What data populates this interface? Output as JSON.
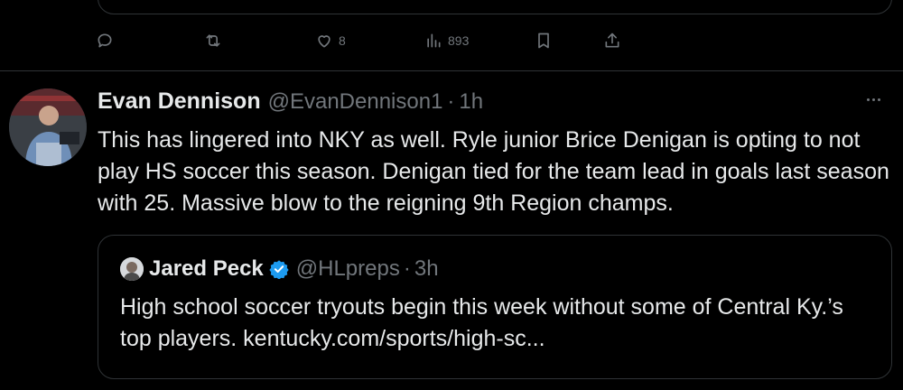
{
  "previous_tweet": {
    "actions": {
      "reply": {
        "icon": "reply-icon",
        "count": ""
      },
      "retweet": {
        "icon": "retweet-icon",
        "count": ""
      },
      "like": {
        "icon": "heart-icon",
        "count": "8"
      },
      "views": {
        "icon": "views-chart-icon",
        "count": "893"
      },
      "bookmark": {
        "icon": "bookmark-icon"
      },
      "share": {
        "icon": "share-icon"
      }
    }
  },
  "tweet": {
    "author_name": "Evan Dennison",
    "handle": "@EvanDennison1",
    "separator": "·",
    "time": "1h",
    "text": "This has lingered into NKY as well. Ryle junior Brice Denigan is opting to not play HS soccer this season. Denigan tied for the team lead in goals last season with 25. Massive blow to the reigning 9th Region champs.",
    "quoted": {
      "author_name": "Jared Peck",
      "verified": true,
      "handle": "@HLpreps",
      "separator": "·",
      "time": "3h",
      "text": "High school soccer tryouts begin this week without some of Central Ky.’s top players. kentucky.com/sports/high-sc..."
    }
  },
  "colors": {
    "background": "#000000",
    "text_primary": "#e7e9ea",
    "text_secondary": "#71767b",
    "border": "#2f3336",
    "verified_blue": "#1d9bf0"
  }
}
